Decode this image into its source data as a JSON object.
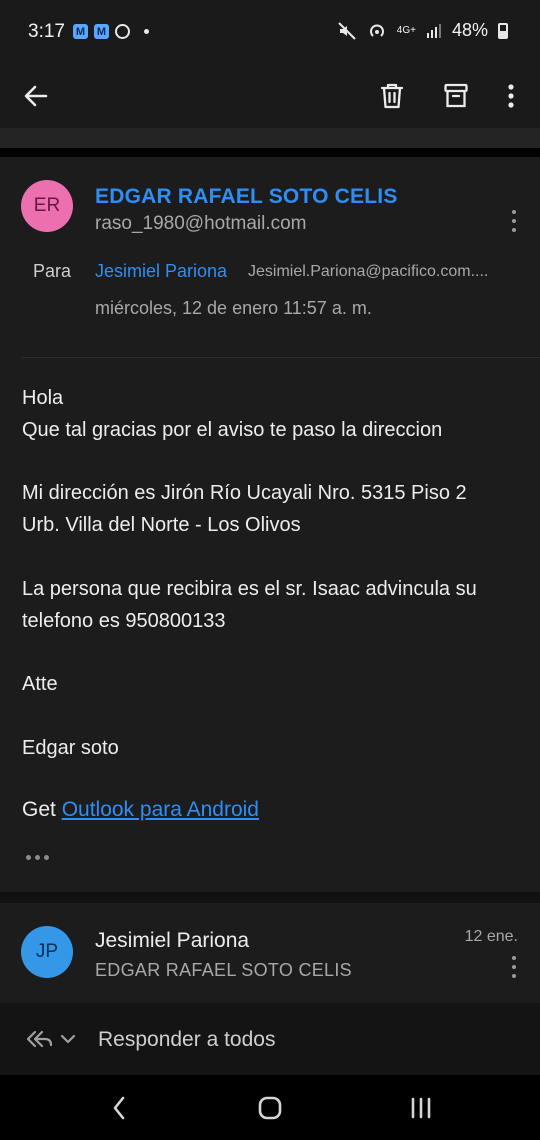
{
  "status_bar": {
    "time": "3:17",
    "network": "4G+",
    "battery": "48%"
  },
  "app_bar": {
    "icons": [
      "back-arrow-icon",
      "trash-icon",
      "archive-icon",
      "more-vert-icon"
    ]
  },
  "message": {
    "avatar_initials": "ER",
    "avatar_color": "#ec6fb0",
    "sender_name": "EDGAR RAFAEL SOTO CELIS",
    "sender_email": "raso_1980@hotmail.com",
    "to_label": "Para",
    "to_name": "Jesimiel Pariona",
    "to_email": "Jesimiel.Pariona@pacifico.com....",
    "date": "miércoles, 12 de enero 11:57 a. m.",
    "body": {
      "line1": "Hola",
      "line2": "Que tal  gracias por el aviso te paso la direccion",
      "line3": "Mi dirección es Jirón Río Ucayali Nro. 5315 Piso 2",
      "line4": "Urb. Villa del Norte - Los Olivos",
      "line5": "La persona que recibira es el sr. Isaac advincula su",
      "line6": "telefono es 950800133",
      "line7": "Atte",
      "line8": "Edgar soto"
    },
    "signature_prefix": "Get ",
    "signature_link": "Outlook para Android"
  },
  "reply_message": {
    "avatar_initials": "JP",
    "avatar_color": "#3597e8",
    "sender_name": "Jesimiel Pariona",
    "recipient": "EDGAR RAFAEL SOTO CELIS",
    "date": "12 ene."
  },
  "reply_bar": {
    "label": "Responder a todos"
  },
  "colors": {
    "accent": "#2f8ef5",
    "background": "#000000",
    "card": "#1c1c1c"
  }
}
